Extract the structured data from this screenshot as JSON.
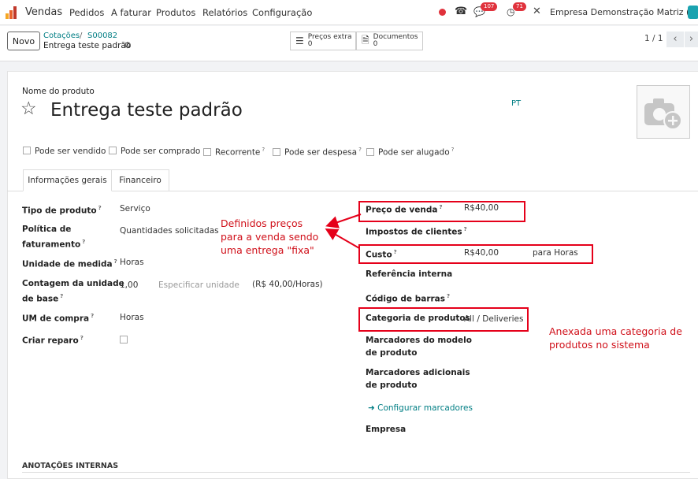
{
  "navbar": {
    "app_name": "Vendas",
    "menu": [
      "Pedidos",
      "A faturar",
      "Produtos",
      "Relatórios",
      "Configuração"
    ],
    "messages_count": "107",
    "activities_count": "71",
    "company": "Empresa Demonstração Matriz (nfe)"
  },
  "controlpanel": {
    "new_label": "Novo",
    "breadcrumb": [
      "Cotações",
      "S00082"
    ],
    "record_title": "Entrega teste padrão",
    "smart_buttons": [
      {
        "label": "Preços extra",
        "count": "0",
        "icon": "list-icon"
      },
      {
        "label": "Documentos",
        "count": "0",
        "icon": "document-icon"
      }
    ],
    "pager": "1 / 1"
  },
  "form": {
    "name_label": "Nome do produto",
    "product_name": "Entrega teste padrão",
    "lang": "PT",
    "checkboxes": [
      "Pode ser vendido",
      "Pode ser comprado",
      "Recorrente",
      "Pode ser despesa",
      "Pode ser alugado"
    ],
    "tabs": [
      "Informações gerais",
      "Financeiro"
    ],
    "left": {
      "product_type_label": "Tipo de produto",
      "product_type": "Serviço",
      "invoice_policy_label_1": "Política de",
      "invoice_policy_label_2": "faturamento",
      "invoice_policy": "Quantidades solicitadas",
      "uom_label": "Unidade de medida",
      "uom": "Horas",
      "base_count_label_1": "Contagem da unidade",
      "base_count_label_2": "de base",
      "base_count": "1,00",
      "base_unit_placeholder": "Especificar unidade",
      "base_price": "(R$ 40,00/Horas)",
      "purchase_uom_label": "UM de compra",
      "purchase_uom": "Horas",
      "create_repair_label": "Criar reparo"
    },
    "right": {
      "sale_price_label": "Preço de venda",
      "sale_price": "R$40,00",
      "taxes_label": "Impostos de clientes",
      "cost_label": "Custo",
      "cost": "R$40,00",
      "cost_per": "para Horas",
      "internal_ref_label": "Referência interna",
      "barcode_label": "Código de barras",
      "category_label": "Categoria de produtos",
      "category": "All / Deliveries",
      "template_tags_label_1": "Marcadores do modelo",
      "template_tags_label_2": "de produto",
      "additional_tags_label_1": "Marcadores adicionais",
      "additional_tags_label_2": "de produto",
      "configure_tags": "Configurar marcadores",
      "company_label": "Empresa"
    },
    "internal_notes": "ANOTAÇÕES INTERNAS"
  },
  "annotations": {
    "prices_note": [
      "Definidos preços",
      "para a venda sendo",
      "uma entrega \"fixa\""
    ],
    "category_note": [
      "Anexada uma categoria de",
      "produtos no sistema"
    ]
  }
}
